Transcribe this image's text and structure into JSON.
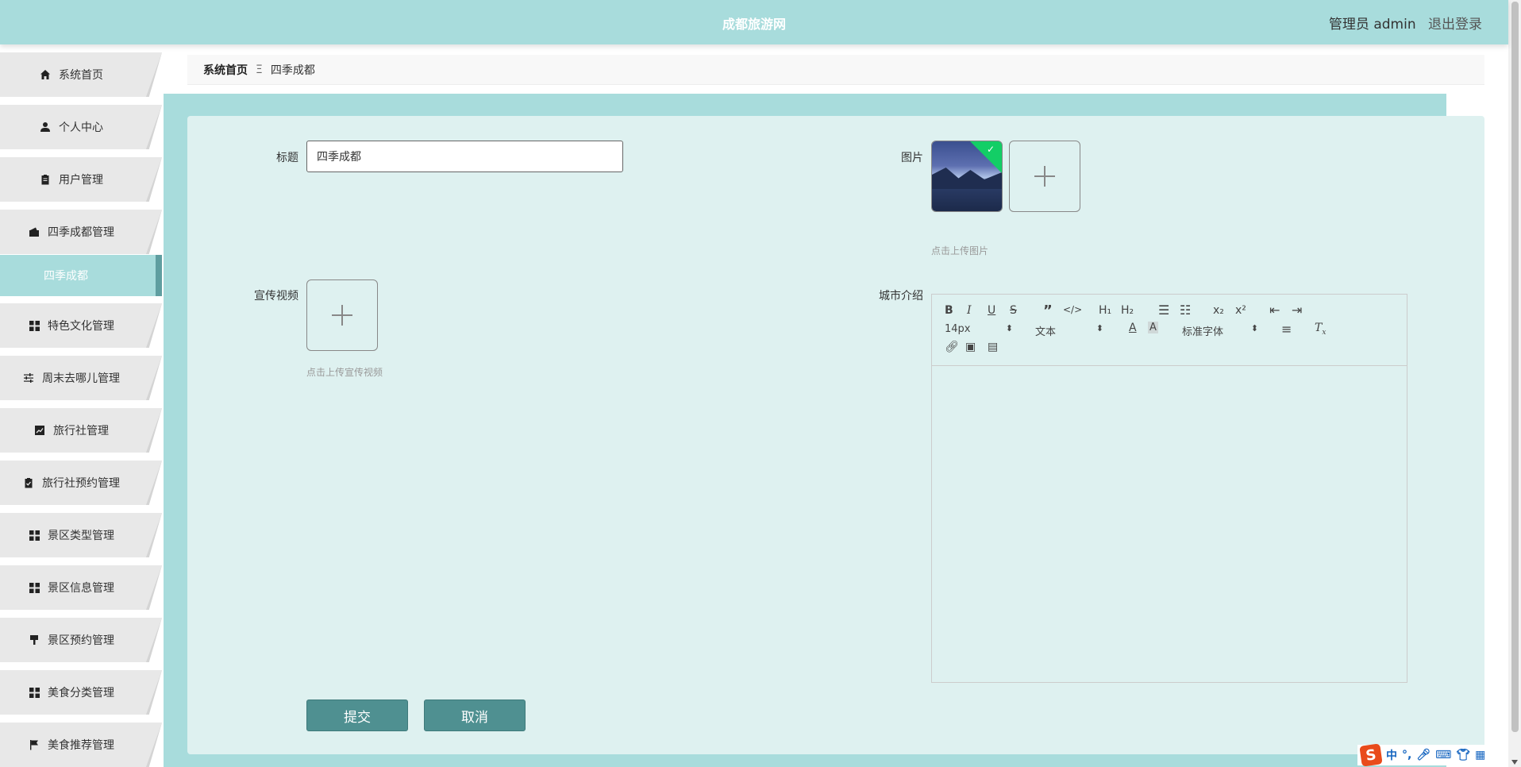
{
  "header": {
    "site_title": "成都旅游网",
    "user_label": "管理员 admin",
    "logout_label": "退出登录"
  },
  "sidebar": {
    "items": [
      {
        "label": "系统首页",
        "icon": "home-icon"
      },
      {
        "label": "个人中心",
        "icon": "user-icon"
      },
      {
        "label": "用户管理",
        "icon": "clipboard-icon"
      },
      {
        "label": "四季成都管理",
        "icon": "wallet-icon"
      },
      {
        "label": "特色文化管理",
        "icon": "grid-icon"
      },
      {
        "label": "周末去哪儿管理",
        "icon": "sliders-icon"
      },
      {
        "label": "旅行社管理",
        "icon": "chart-icon"
      },
      {
        "label": "旅行社预约管理",
        "icon": "clipboard-check-icon"
      },
      {
        "label": "景区类型管理",
        "icon": "grid-icon"
      },
      {
        "label": "景区信息管理",
        "icon": "grid-icon"
      },
      {
        "label": "景区预约管理",
        "icon": "brush-icon"
      },
      {
        "label": "美食分类管理",
        "icon": "grid-icon"
      },
      {
        "label": "美食推荐管理",
        "icon": "flag-icon"
      }
    ],
    "active_sub_item": "四季成都"
  },
  "breadcrumb": {
    "home": "系统首页",
    "separator": "Ξ",
    "current": "四季成都"
  },
  "form": {
    "title_label": "标题",
    "title_value": "四季成都",
    "picture_label": "图片",
    "picture_hint": "点击上传图片",
    "video_label": "宣传视频",
    "video_hint": "点击上传宣传视频",
    "intro_label": "城市介绍",
    "editor": {
      "font_size": "14px",
      "header_select": "文本",
      "font_family": "标准字体"
    },
    "submit_label": "提交",
    "cancel_label": "取消"
  },
  "ime": {
    "lang": "中",
    "punct": "°,"
  },
  "colors": {
    "header_bg": "#a8dcdc",
    "panel_bg": "#def1f0",
    "button_bg": "#4f9091",
    "active_menu": "#a8dcdc"
  }
}
